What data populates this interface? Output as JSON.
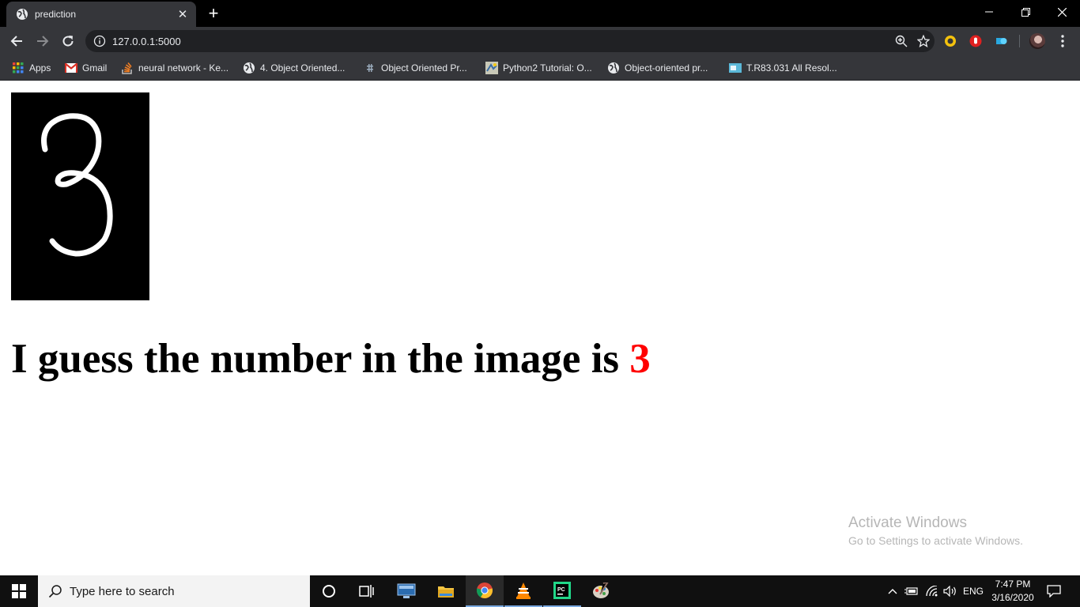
{
  "browser": {
    "tab_title": "prediction",
    "tab_close": "✕",
    "new_tab": "+",
    "url": "127.0.0.1:5000",
    "bookmarks": [
      {
        "label": "Apps"
      },
      {
        "label": "Gmail"
      },
      {
        "label": "neural network - Ke..."
      },
      {
        "label": "4. Object Oriented..."
      },
      {
        "label": "Object Oriented Pr..."
      },
      {
        "label": "Python2 Tutorial: O..."
      },
      {
        "label": "Object-oriented pr..."
      },
      {
        "label": "T.R83.031 All Resol..."
      }
    ]
  },
  "page": {
    "image_digit": "3",
    "result_text": "I guess the number in the image is ",
    "predicted_digit": "3",
    "predicted_color": "#ff0000"
  },
  "watermark": {
    "line1": "Activate Windows",
    "line2": "Go to Settings to activate Windows."
  },
  "taskbar": {
    "search_placeholder": "Type here to search",
    "language": "ENG",
    "time": "7:47 PM",
    "date": "3/16/2020"
  }
}
